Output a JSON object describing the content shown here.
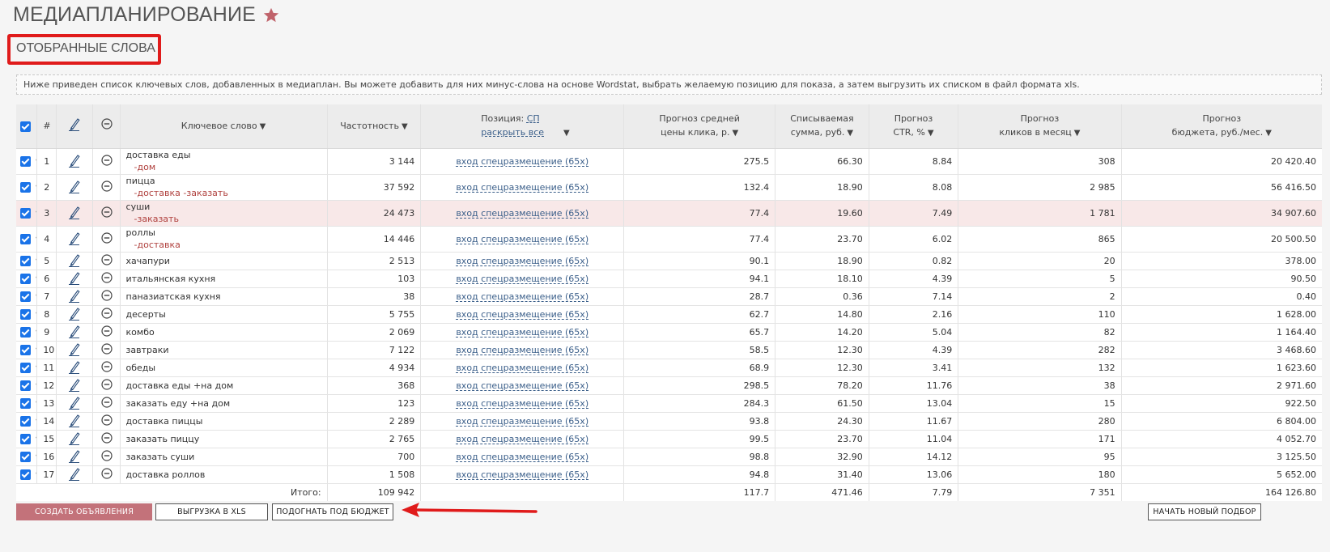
{
  "page": {
    "title": "МЕДИАПЛАНИРОВАНИЕ",
    "section_title": "ОТОБРАННЫЕ СЛОВА",
    "info": "Ниже приведен список ключевых слов, добавленных в медиаплан. Вы можете добавить для них минус-слова на основе Wordstat, выбрать желаемую позицию для показа, а затем выгрузить их списком в файл формата xls."
  },
  "colors": {
    "accent": "#c3727a",
    "annotation_red": "#e01b1b",
    "link": "#3b5f8a",
    "minus_word": "#b0413e",
    "checkbox": "#1a73e8",
    "star": "#c0636b"
  },
  "icons": {
    "star": "star-icon",
    "edit": "pencil-icon",
    "remove": "minus-circle-icon",
    "sort": "sort-down-triangle",
    "row_menu": "caret-down-icon"
  },
  "table": {
    "headers": {
      "num": "#",
      "keyword": "Ключевое слово",
      "frequency": "Частотность",
      "position": "Позиция:",
      "position_link": "СП",
      "position_expand": "раскрыть все",
      "cpc_1": "Прогноз средней",
      "cpc_2": "цены клика, р.",
      "charge_1": "Списываемая",
      "charge_2": "сумма, руб.",
      "ctr_1": "Прогноз",
      "ctr_2": "CTR, %",
      "clicks_1": "Прогноз",
      "clicks_2": "кликов в месяц",
      "budget_1": "Прогноз",
      "budget_2": "бюджета, руб./мес.",
      "sort_arrow": "▼"
    },
    "rows": [
      {
        "num": "1",
        "keyword": "доставка еды",
        "minus": "-дом",
        "frequency": "3 144",
        "position": "вход спецразмещение (65х)",
        "cpc": "275.5",
        "charge": "66.30",
        "ctr": "8.84",
        "clicks": "308",
        "budget": "20 420.40",
        "checked": true
      },
      {
        "num": "2",
        "keyword": "пицца",
        "minus": "-доставка -заказать",
        "frequency": "37 592",
        "position": "вход спецразмещение (65х)",
        "cpc": "132.4",
        "charge": "18.90",
        "ctr": "8.08",
        "clicks": "2 985",
        "budget": "56 416.50",
        "checked": true
      },
      {
        "num": "3",
        "keyword": "суши",
        "minus": "-заказать",
        "frequency": "24 473",
        "position": "вход спецразмещение (65х)",
        "cpc": "77.4",
        "charge": "19.60",
        "ctr": "7.49",
        "clicks": "1 781",
        "budget": "34 907.60",
        "checked": true,
        "highlighted": true
      },
      {
        "num": "4",
        "keyword": "роллы",
        "minus": "-доставка",
        "frequency": "14 446",
        "position": "вход спецразмещение (65х)",
        "cpc": "77.4",
        "charge": "23.70",
        "ctr": "6.02",
        "clicks": "865",
        "budget": "20 500.50",
        "checked": true
      },
      {
        "num": "5",
        "keyword": "хачапури",
        "minus": "",
        "frequency": "2 513",
        "position": "вход спецразмещение (65х)",
        "cpc": "90.1",
        "charge": "18.90",
        "ctr": "0.82",
        "clicks": "20",
        "budget": "378.00",
        "checked": true
      },
      {
        "num": "6",
        "keyword": "итальянская кухня",
        "minus": "",
        "frequency": "103",
        "position": "вход спецразмещение (65х)",
        "cpc": "94.1",
        "charge": "18.10",
        "ctr": "4.39",
        "clicks": "5",
        "budget": "90.50",
        "checked": true
      },
      {
        "num": "7",
        "keyword": "паназиатская кухня",
        "minus": "",
        "frequency": "38",
        "position": "вход спецразмещение (65х)",
        "cpc": "28.7",
        "charge": "0.36",
        "ctr": "7.14",
        "clicks": "2",
        "budget": "0.40",
        "checked": true
      },
      {
        "num": "8",
        "keyword": "десерты",
        "minus": "",
        "frequency": "5 755",
        "position": "вход спецразмещение (65х)",
        "cpc": "62.7",
        "charge": "14.80",
        "ctr": "2.16",
        "clicks": "110",
        "budget": "1 628.00",
        "checked": true
      },
      {
        "num": "9",
        "keyword": "комбо",
        "minus": "",
        "frequency": "2 069",
        "position": "вход спецразмещение (65х)",
        "cpc": "65.7",
        "charge": "14.20",
        "ctr": "5.04",
        "clicks": "82",
        "budget": "1 164.40",
        "checked": true
      },
      {
        "num": "10",
        "keyword": "завтраки",
        "minus": "",
        "frequency": "7 122",
        "position": "вход спецразмещение (65х)",
        "cpc": "58.5",
        "charge": "12.30",
        "ctr": "4.39",
        "clicks": "282",
        "budget": "3 468.60",
        "checked": true
      },
      {
        "num": "11",
        "keyword": "обеды",
        "minus": "",
        "frequency": "4 934",
        "position": "вход спецразмещение (65х)",
        "cpc": "68.9",
        "charge": "12.30",
        "ctr": "3.41",
        "clicks": "132",
        "budget": "1 623.60",
        "checked": true
      },
      {
        "num": "12",
        "keyword": "доставка еды +на дом",
        "minus": "",
        "frequency": "368",
        "position": "вход спецразмещение (65х)",
        "cpc": "298.5",
        "charge": "78.20",
        "ctr": "11.76",
        "clicks": "38",
        "budget": "2 971.60",
        "checked": true
      },
      {
        "num": "13",
        "keyword": "заказать еду +на дом",
        "minus": "",
        "frequency": "123",
        "position": "вход спецразмещение (65х)",
        "cpc": "284.3",
        "charge": "61.50",
        "ctr": "13.04",
        "clicks": "15",
        "budget": "922.50",
        "checked": true
      },
      {
        "num": "14",
        "keyword": "доставка пиццы",
        "minus": "",
        "frequency": "2 289",
        "position": "вход спецразмещение (65х)",
        "cpc": "93.8",
        "charge": "24.30",
        "ctr": "11.67",
        "clicks": "280",
        "budget": "6 804.00",
        "checked": true
      },
      {
        "num": "15",
        "keyword": "заказать пиццу",
        "minus": "",
        "frequency": "2 765",
        "position": "вход спецразмещение (65х)",
        "cpc": "99.5",
        "charge": "23.70",
        "ctr": "11.04",
        "clicks": "171",
        "budget": "4 052.70",
        "checked": true
      },
      {
        "num": "16",
        "keyword": "заказать суши",
        "minus": "",
        "frequency": "700",
        "position": "вход спецразмещение (65х)",
        "cpc": "98.8",
        "charge": "32.90",
        "ctr": "14.12",
        "clicks": "95",
        "budget": "3 125.50",
        "checked": true
      },
      {
        "num": "17",
        "keyword": "доставка роллов",
        "minus": "",
        "frequency": "1 508",
        "position": "вход спецразмещение (65х)",
        "cpc": "94.8",
        "charge": "31.40",
        "ctr": "13.06",
        "clicks": "180",
        "budget": "5 652.00",
        "checked": true
      }
    ],
    "totals": {
      "label": "Итого:",
      "frequency": "109 942",
      "cpc": "117.7",
      "charge": "471.46",
      "ctr": "7.79",
      "clicks": "7 351",
      "budget": "164 126.80"
    }
  },
  "buttons": {
    "create_ads": "СОЗДАТЬ ОБЪЯВЛЕНИЯ",
    "export_xls": "ВЫГРУЗКА В XLS",
    "fit_budget": "ПОДОГНАТЬ ПОД БЮДЖЕТ",
    "new_search": "НАЧАТЬ НОВЫЙ ПОДБОР"
  }
}
